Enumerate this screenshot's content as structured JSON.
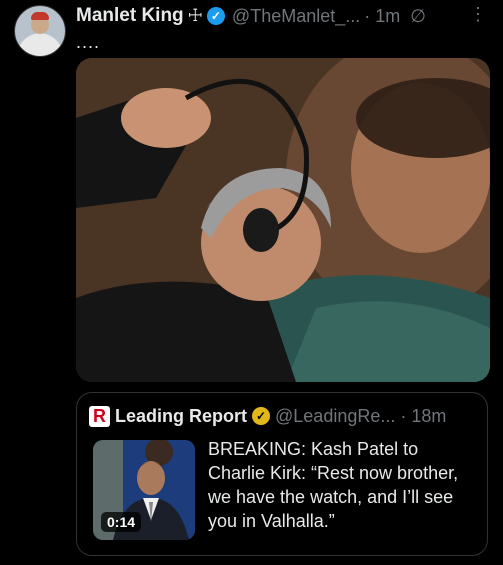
{
  "post": {
    "author_name": "Manlet King",
    "cross_glyph": "☩",
    "verified_glyph": "✓",
    "handle": "@TheManlet_...",
    "time": "· 1m",
    "grok_glyph": "∅",
    "more_glyph": "⋮",
    "text": "...."
  },
  "quoted": {
    "logo_letter": "R",
    "name": "Leading Report",
    "verified_glyph": "✓",
    "handle": "@LeadingRe...",
    "time": "· 18m",
    "video_duration": "0:14",
    "text": "BREAKING: Kash Patel to Charlie Kirk: “Rest now brother, we have the watch, and I’ll see you in Valhalla.”"
  },
  "colors": {
    "background": "#000000",
    "text": "#e7e9ea",
    "muted": "#71767b",
    "verified_blue": "#1d9bf0",
    "verified_gold": "#e2b719",
    "logo_red": "#d0021b"
  }
}
